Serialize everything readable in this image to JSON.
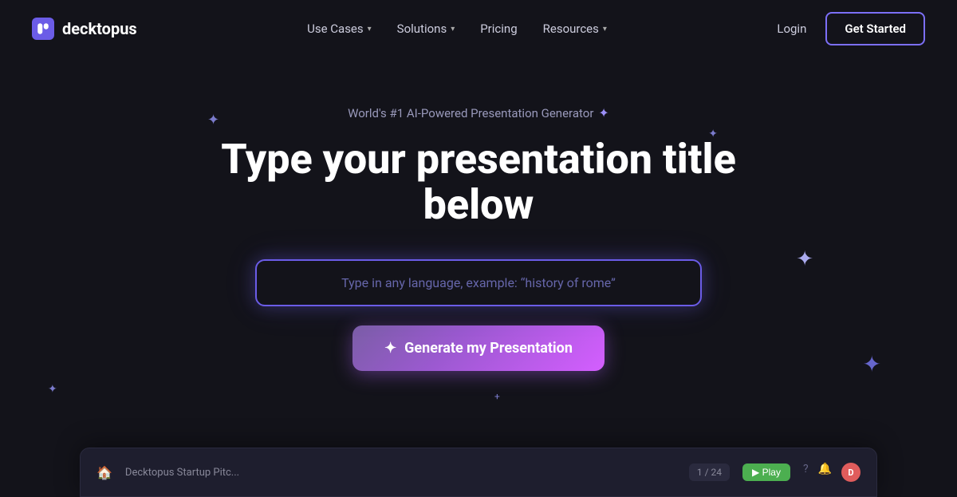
{
  "brand": {
    "logo_text": "decktopus",
    "logo_icon": "d"
  },
  "nav": {
    "items": [
      {
        "label": "Use Cases",
        "has_dropdown": true
      },
      {
        "label": "Solutions",
        "has_dropdown": true
      },
      {
        "label": "Pricing",
        "has_dropdown": false
      },
      {
        "label": "Resources",
        "has_dropdown": true
      }
    ],
    "login_label": "Login",
    "get_started_label": "Get Started"
  },
  "hero": {
    "subtitle": "World's #1 AI-Powered Presentation Generator",
    "title": "Type your presentation title below",
    "input_placeholder": "Type in any language, example: “history of rome”",
    "generate_button_label": "Generate my Presentation",
    "generate_button_icon": "✦"
  },
  "preview": {
    "title": "Decktopus Startup Pitc...",
    "progress": "1 / 24",
    "play_label": "▶ Play"
  },
  "sparkles": {
    "colors": {
      "accent": "#7b7bcc",
      "accent_bright": "#aaaaee",
      "accent_dim": "#6666cc",
      "brand_purple": "#7c6ff7"
    }
  }
}
